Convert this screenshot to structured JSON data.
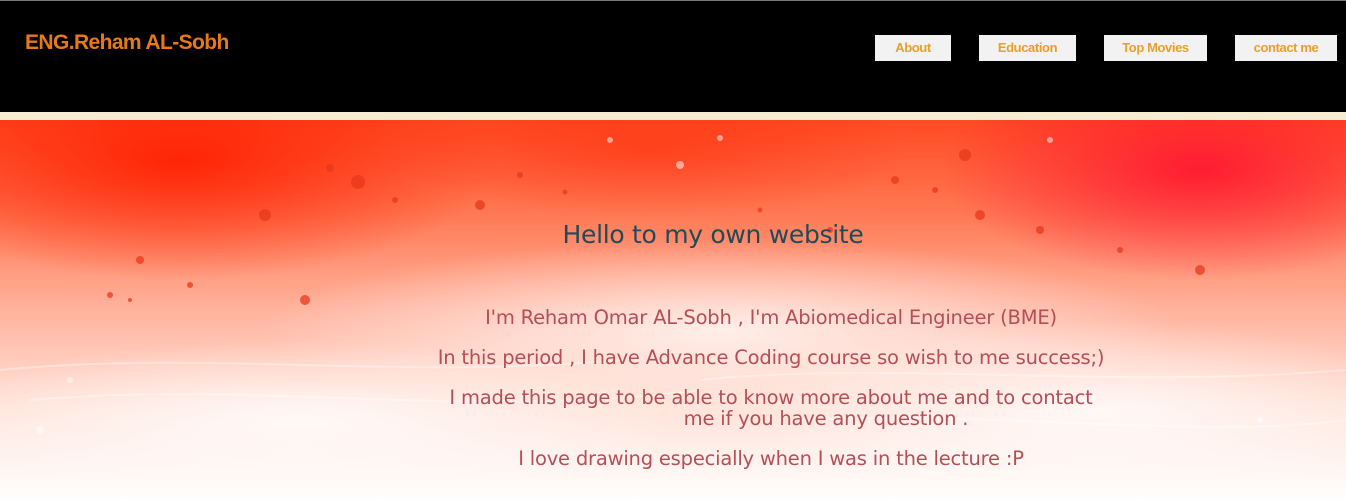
{
  "header": {
    "brand": "ENG.Reham AL-Sobh",
    "nav": [
      {
        "label": "About"
      },
      {
        "label": "Education"
      },
      {
        "label": "Top Movies"
      },
      {
        "label": "contact me"
      }
    ]
  },
  "hero": {
    "title": "Hello to my own website",
    "lines": [
      "I'm Reham Omar AL-Sobh , I'm Abiomedical Engineer (BME)",
      "In this period , I have  Advance Coding course so wish to me success;)",
      "I made this page to be able to know more about  me and to contact",
      "me if you have any question .",
      "I love drawing especially when I was in the lecture :P"
    ]
  },
  "colors": {
    "header_bg": "#000000",
    "brand": "#e87a16",
    "nav_bg": "#f2f2f2",
    "nav_text": "#e8a02a",
    "title": "#1f4a5a",
    "body_text": "#b54e57",
    "splash": "#ff3b1f"
  }
}
